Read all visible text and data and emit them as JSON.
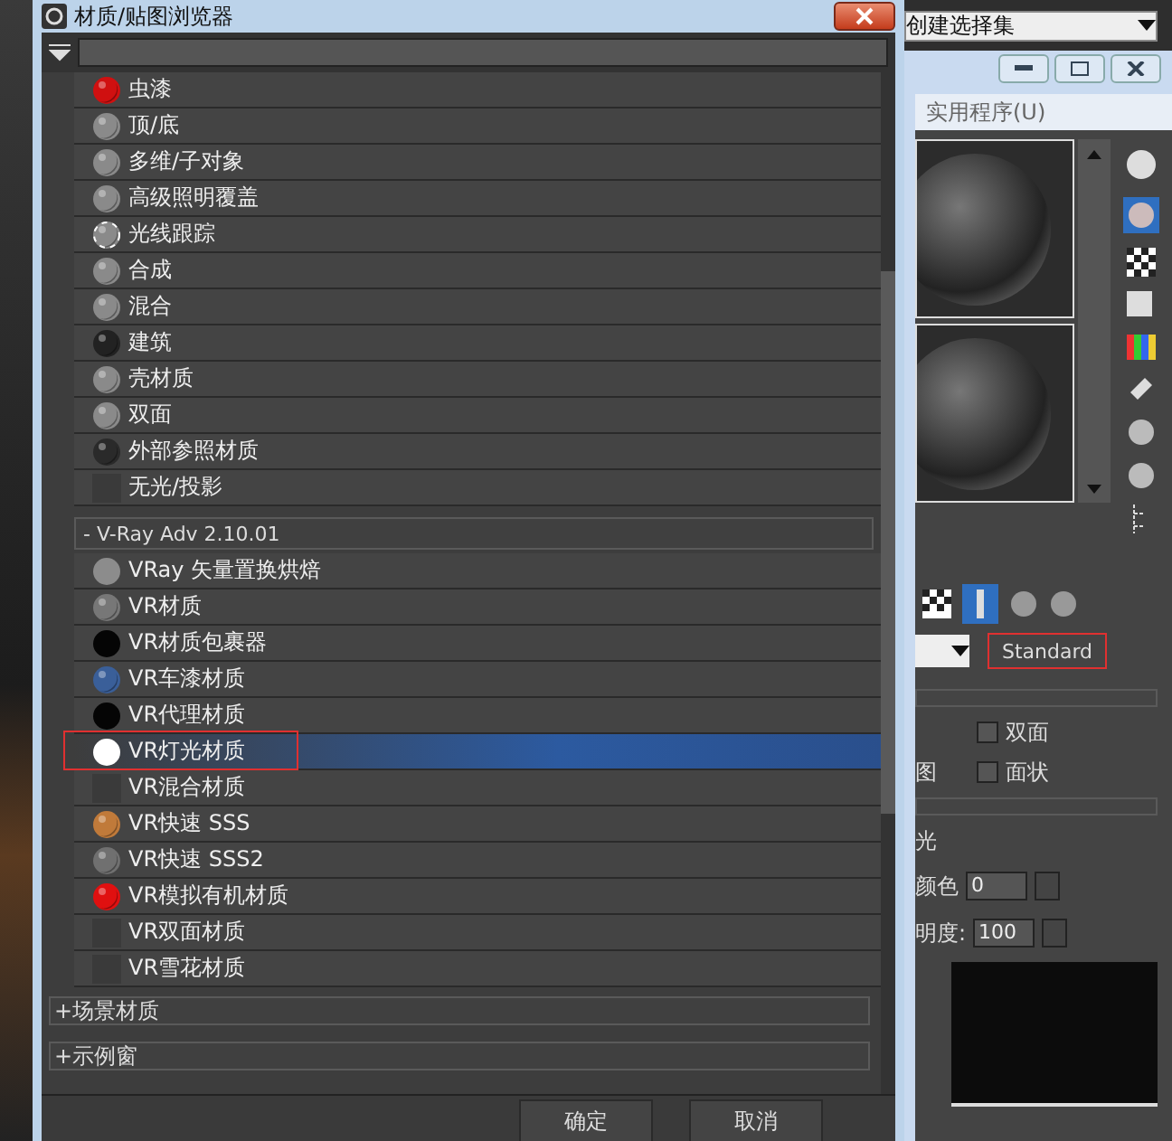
{
  "browser": {
    "title": "材质/贴图浏览器",
    "items": [
      {
        "label": "虫漆",
        "kind": "sphere",
        "color": "#d01010",
        "selected": false,
        "annotated": false
      },
      {
        "label": "顶/底",
        "kind": "sphere",
        "color": "#8a8a8a",
        "selected": false,
        "annotated": false
      },
      {
        "label": "多维/子对象",
        "kind": "sphere",
        "color": "#8a8a8a",
        "selected": false,
        "annotated": false
      },
      {
        "label": "高级照明覆盖",
        "kind": "sphere",
        "color": "#8a8a8a",
        "selected": false,
        "annotated": false
      },
      {
        "label": "光线跟踪",
        "kind": "raytrace",
        "color": "#8a8a8a",
        "selected": false,
        "annotated": false
      },
      {
        "label": "合成",
        "kind": "sphere",
        "color": "#8a8a8a",
        "selected": false,
        "annotated": false
      },
      {
        "label": "混合",
        "kind": "sphere",
        "color": "#8a8a8a",
        "selected": false,
        "annotated": false
      },
      {
        "label": "建筑",
        "kind": "sphere",
        "color": "#222222",
        "selected": false,
        "annotated": false
      },
      {
        "label": "壳材质",
        "kind": "sphere",
        "color": "#8a8a8a",
        "selected": false,
        "annotated": false
      },
      {
        "label": "双面",
        "kind": "sphere",
        "color": "#8a8a8a",
        "selected": false,
        "annotated": false
      },
      {
        "label": "外部参照材质",
        "kind": "sphere",
        "color": "#2a2a2a",
        "selected": false,
        "annotated": false
      },
      {
        "label": "无光/投影",
        "kind": "flat",
        "color": "#3a3a3a",
        "selected": false,
        "annotated": false
      }
    ],
    "sections": [
      {
        "title": "V-Ray Adv 2.10.01",
        "sign": "-",
        "expanded": true,
        "items": [
          {
            "label": "VRay 矢量置换烘焙",
            "kind": "disc",
            "color": "#8c8c8c",
            "selected": false,
            "annotated": false
          },
          {
            "label": "VR材质",
            "kind": "sphere",
            "color": "#777777",
            "selected": false,
            "annotated": false
          },
          {
            "label": "VR材质包裹器",
            "kind": "disc",
            "color": "#050505",
            "selected": false,
            "annotated": false
          },
          {
            "label": "VR车漆材质",
            "kind": "sphere",
            "color": "#3a5f99",
            "selected": false,
            "annotated": false
          },
          {
            "label": "VR代理材质",
            "kind": "disc",
            "color": "#050505",
            "selected": false,
            "annotated": false
          },
          {
            "label": "VR灯光材质",
            "kind": "disc",
            "color": "#ffffff",
            "selected": true,
            "annotated": true
          },
          {
            "label": "VR混合材质",
            "kind": "flat",
            "color": "#3a3a3a",
            "selected": false,
            "annotated": false
          },
          {
            "label": "VR快速 SSS",
            "kind": "sphere",
            "color": "#c07a3a",
            "selected": false,
            "annotated": false
          },
          {
            "label": "VR快速 SSS2",
            "kind": "sphere",
            "color": "#707070",
            "selected": false,
            "annotated": false
          },
          {
            "label": "VR模拟有机材质",
            "kind": "sphere",
            "color": "#e01010",
            "selected": false,
            "annotated": false
          },
          {
            "label": "VR双面材质",
            "kind": "flat",
            "color": "#3a3a3a",
            "selected": false,
            "annotated": false
          },
          {
            "label": "VR雪花材质",
            "kind": "flat",
            "color": "#3a3a3a",
            "selected": false,
            "annotated": false
          }
        ]
      },
      {
        "title": "场景材质",
        "sign": "+",
        "expanded": false
      },
      {
        "title": "示例窗",
        "sign": "+",
        "expanded": false
      }
    ],
    "buttons": [
      "确定",
      "取消"
    ]
  },
  "named_selection": {
    "value": "创建选择集"
  },
  "editor": {
    "menu": "实用程序(U)",
    "type_button": {
      "label": "Standard",
      "annotated": true
    },
    "checkboxes": [
      {
        "label": "双面",
        "checked": false
      },
      {
        "side_label": "图",
        "label": "面状",
        "checked": false
      }
    ],
    "self_illumination": {
      "title": "光",
      "label": "颜色",
      "value": "0"
    },
    "opacity": {
      "label": "明度:",
      "value": "100"
    }
  }
}
